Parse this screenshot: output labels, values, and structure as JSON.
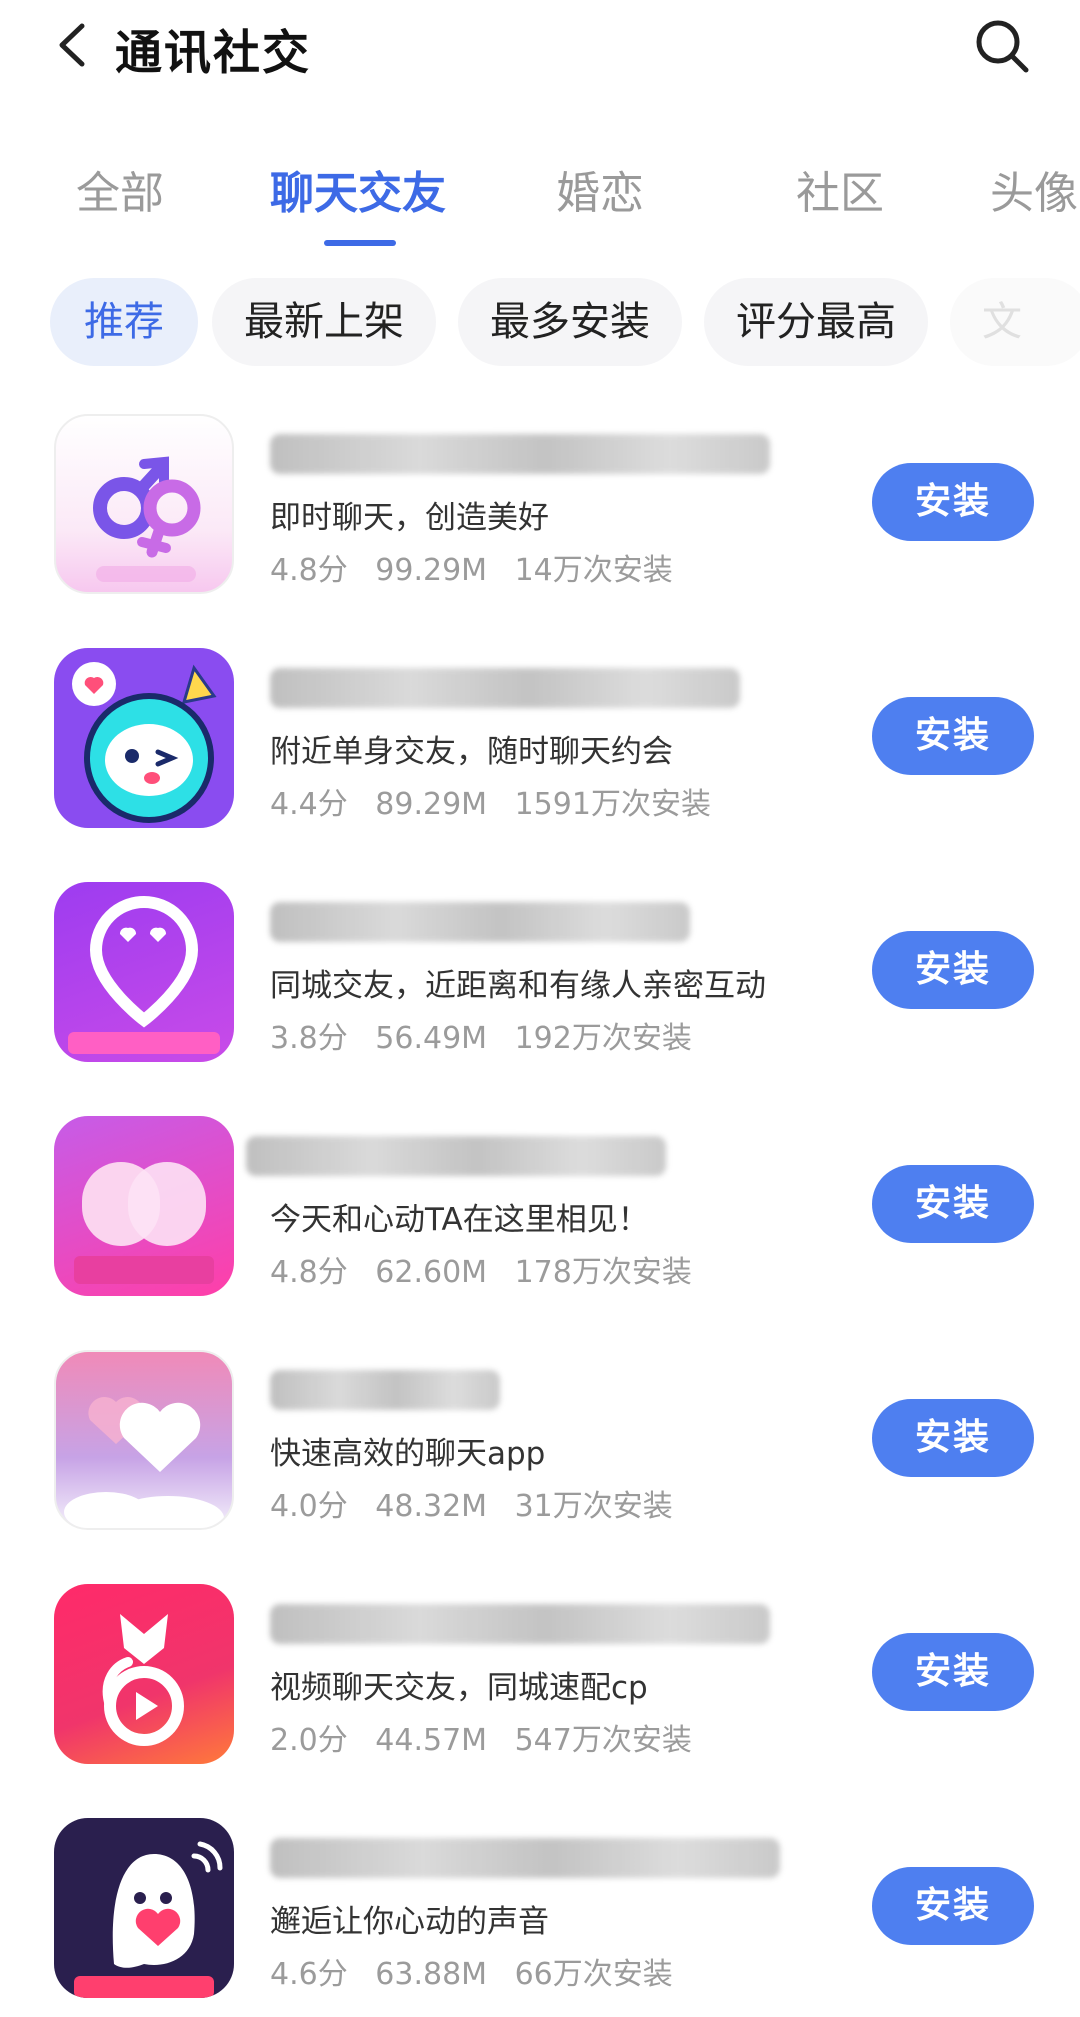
{
  "header": {
    "title": "通讯社交",
    "back_icon": "back-arrow-icon",
    "search_icon": "search-icon"
  },
  "tabs": [
    {
      "label": "全部",
      "active": false
    },
    {
      "label": "聊天交友",
      "active": true
    },
    {
      "label": "婚恋",
      "active": false
    },
    {
      "label": "社区",
      "active": false
    },
    {
      "label": "头像",
      "active": false
    }
  ],
  "filters": [
    {
      "label": "推荐",
      "active": true
    },
    {
      "label": "最新上架",
      "active": false
    },
    {
      "label": "最多安装",
      "active": false
    },
    {
      "label": "评分最高",
      "active": false
    },
    {
      "label": "文",
      "active": false
    }
  ],
  "accent": "#3d6ae6",
  "install_color": "#4e7ff0",
  "apps": [
    {
      "desc": "即时聊天，创造美好",
      "rating": "4.8分",
      "size": "99.29M",
      "installs": "14万次安装",
      "install_label": "安装"
    },
    {
      "desc": "附近单身交友，随时聊天约会",
      "rating": "4.4分",
      "size": "89.29M",
      "installs": "1591万次安装",
      "install_label": "安装"
    },
    {
      "desc": "同城交友，近距离和有缘人亲密互动",
      "rating": "3.8分",
      "size": "56.49M",
      "installs": "192万次安装",
      "install_label": "安装"
    },
    {
      "desc": "今天和心动TA在这里相见！",
      "rating": "4.8分",
      "size": "62.60M",
      "installs": "178万次安装",
      "install_label": "安装"
    },
    {
      "desc": "快速高效的聊天app",
      "rating": "4.0分",
      "size": "48.32M",
      "installs": "31万次安装",
      "install_label": "安装"
    },
    {
      "desc": "视频聊天交友，同城速配cp",
      "rating": "2.0分",
      "size": "44.57M",
      "installs": "547万次安装",
      "install_label": "安装"
    },
    {
      "desc": "邂逅让你心动的声音",
      "rating": "4.6分",
      "size": "63.88M",
      "installs": "66万次安装",
      "install_label": "安装"
    }
  ]
}
